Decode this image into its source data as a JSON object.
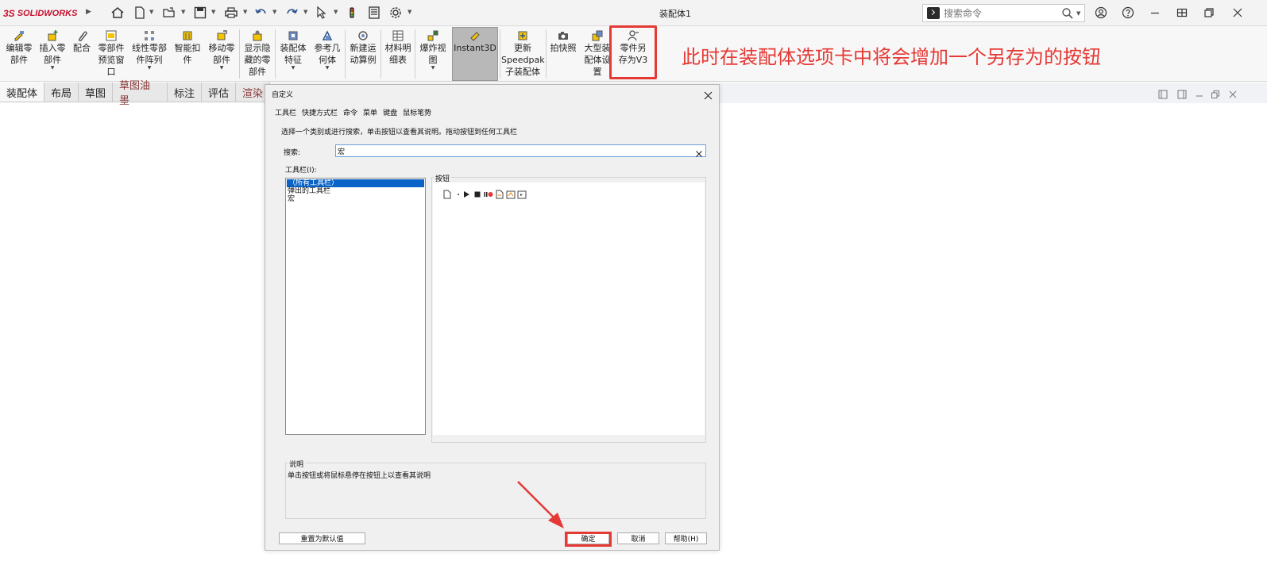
{
  "app": {
    "logo_prefix": "3S",
    "logo_name": "SOLIDWORKS",
    "document_title": "装配体1"
  },
  "search": {
    "placeholder": "搜索命令"
  },
  "ribbon": {
    "items": [
      {
        "label": "编辑零\n部件"
      },
      {
        "label": "插入零\n部件"
      },
      {
        "label": "配合"
      },
      {
        "label": "零部件\n预览窗\n口"
      },
      {
        "label": "线性零部\n件阵列"
      },
      {
        "label": "智能扣\n件"
      },
      {
        "label": "移动零\n部件"
      },
      {
        "label": "显示隐\n藏的零\n部件"
      },
      {
        "label": "装配体\n特征"
      },
      {
        "label": "参考几\n何体"
      },
      {
        "label": "新建运\n动算例"
      },
      {
        "label": "材料明\n细表"
      },
      {
        "label": "爆炸视\n图"
      },
      {
        "label": "Instant3D"
      },
      {
        "label": "更新\nSpeedpak\n子装配体"
      },
      {
        "label": "拍快照"
      },
      {
        "label": "大型装\n配体设\n置"
      },
      {
        "label": "零件另\n存为V3"
      }
    ]
  },
  "annotation": "此时在装配体选项卡中将会增加一个另存为的按钮",
  "command_tabs": [
    "装配体",
    "布局",
    "草图",
    "草图油墨",
    "标注",
    "评估",
    "渲染"
  ],
  "dialog": {
    "title": "自定义",
    "tabs": [
      "工具栏",
      "快捷方式栏",
      "命令",
      "菜单",
      "键盘",
      "鼠标笔势"
    ],
    "instructions": "选择一个类别或进行搜索，单击按钮以查看其说明。拖动按钮到任何工具栏",
    "search_label": "搜索:",
    "search_value": "宏",
    "toolbars_label": "工具栏(I):",
    "toolbar_items": [
      "（所有工具栏）",
      "弹出的工具栏",
      "宏"
    ],
    "buttons_label": "按钮",
    "description_label": "说明",
    "description_text": "单击按钮或将鼠标悬停在按钮上以查看其说明",
    "reset_button": "重置为默认值",
    "ok_button": "确定",
    "cancel_button": "取消",
    "help_button": "帮助(H)"
  },
  "colors": {
    "annotation_red": "#e53935",
    "selection_blue": "#0a64c8"
  }
}
